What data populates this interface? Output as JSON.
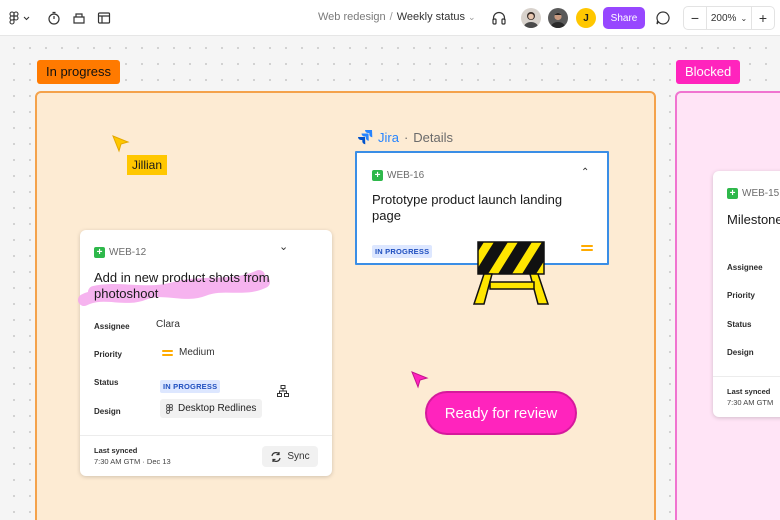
{
  "toolbar": {
    "breadcrumb_project": "Web redesign",
    "breadcrumb_separator": "/",
    "breadcrumb_page": "Weekly status",
    "avatar_initial": "J",
    "share_label": "Share",
    "zoom_minus": "−",
    "zoom_level": "200%",
    "zoom_plus": "+",
    "icons": [
      "figma-menu-icon",
      "timer-icon",
      "widgets-icon",
      "layout-icon",
      "headphones-icon",
      "comment-icon"
    ]
  },
  "sections": {
    "in_progress_label": "In progress",
    "blocked_label": "Blocked"
  },
  "cursor_tag": "Jillian",
  "jira_header": {
    "app": "Jira",
    "dot": "·",
    "subtitle": "Details"
  },
  "card_web16": {
    "key": "WEB-16",
    "title": "Prototype product launch landing page",
    "status": "IN PROGRESS"
  },
  "card_web12": {
    "key": "WEB-12",
    "title": "Add in new product shots from photoshoot",
    "assignee_label": "Assignee",
    "assignee": "Clara",
    "priority_label": "Priority",
    "priority": "Medium",
    "status_label": "Status",
    "status": "IN PROGRESS",
    "design_label": "Design",
    "design": "Desktop Redlines",
    "last_synced_label": "Last synced",
    "last_synced": "7:30 AM GTM · Dec 13",
    "sync_label": "Sync"
  },
  "card_web15": {
    "key": "WEB-15",
    "title": "Milestone",
    "assignee_label": "Assignee",
    "priority_label": "Priority",
    "status_label": "Status",
    "design_label": "Design",
    "last_synced_label": "Last synced",
    "last_synced": "7:30 AM GTM"
  },
  "review_pill": "Ready for review",
  "colors": {
    "accent_purple": "#9747ff",
    "in_progress_orange": "#ff7a00",
    "blocked_pink": "#ff24bd",
    "jira_blue": "#2684ff",
    "cursor_yellow": "#ffc700"
  }
}
